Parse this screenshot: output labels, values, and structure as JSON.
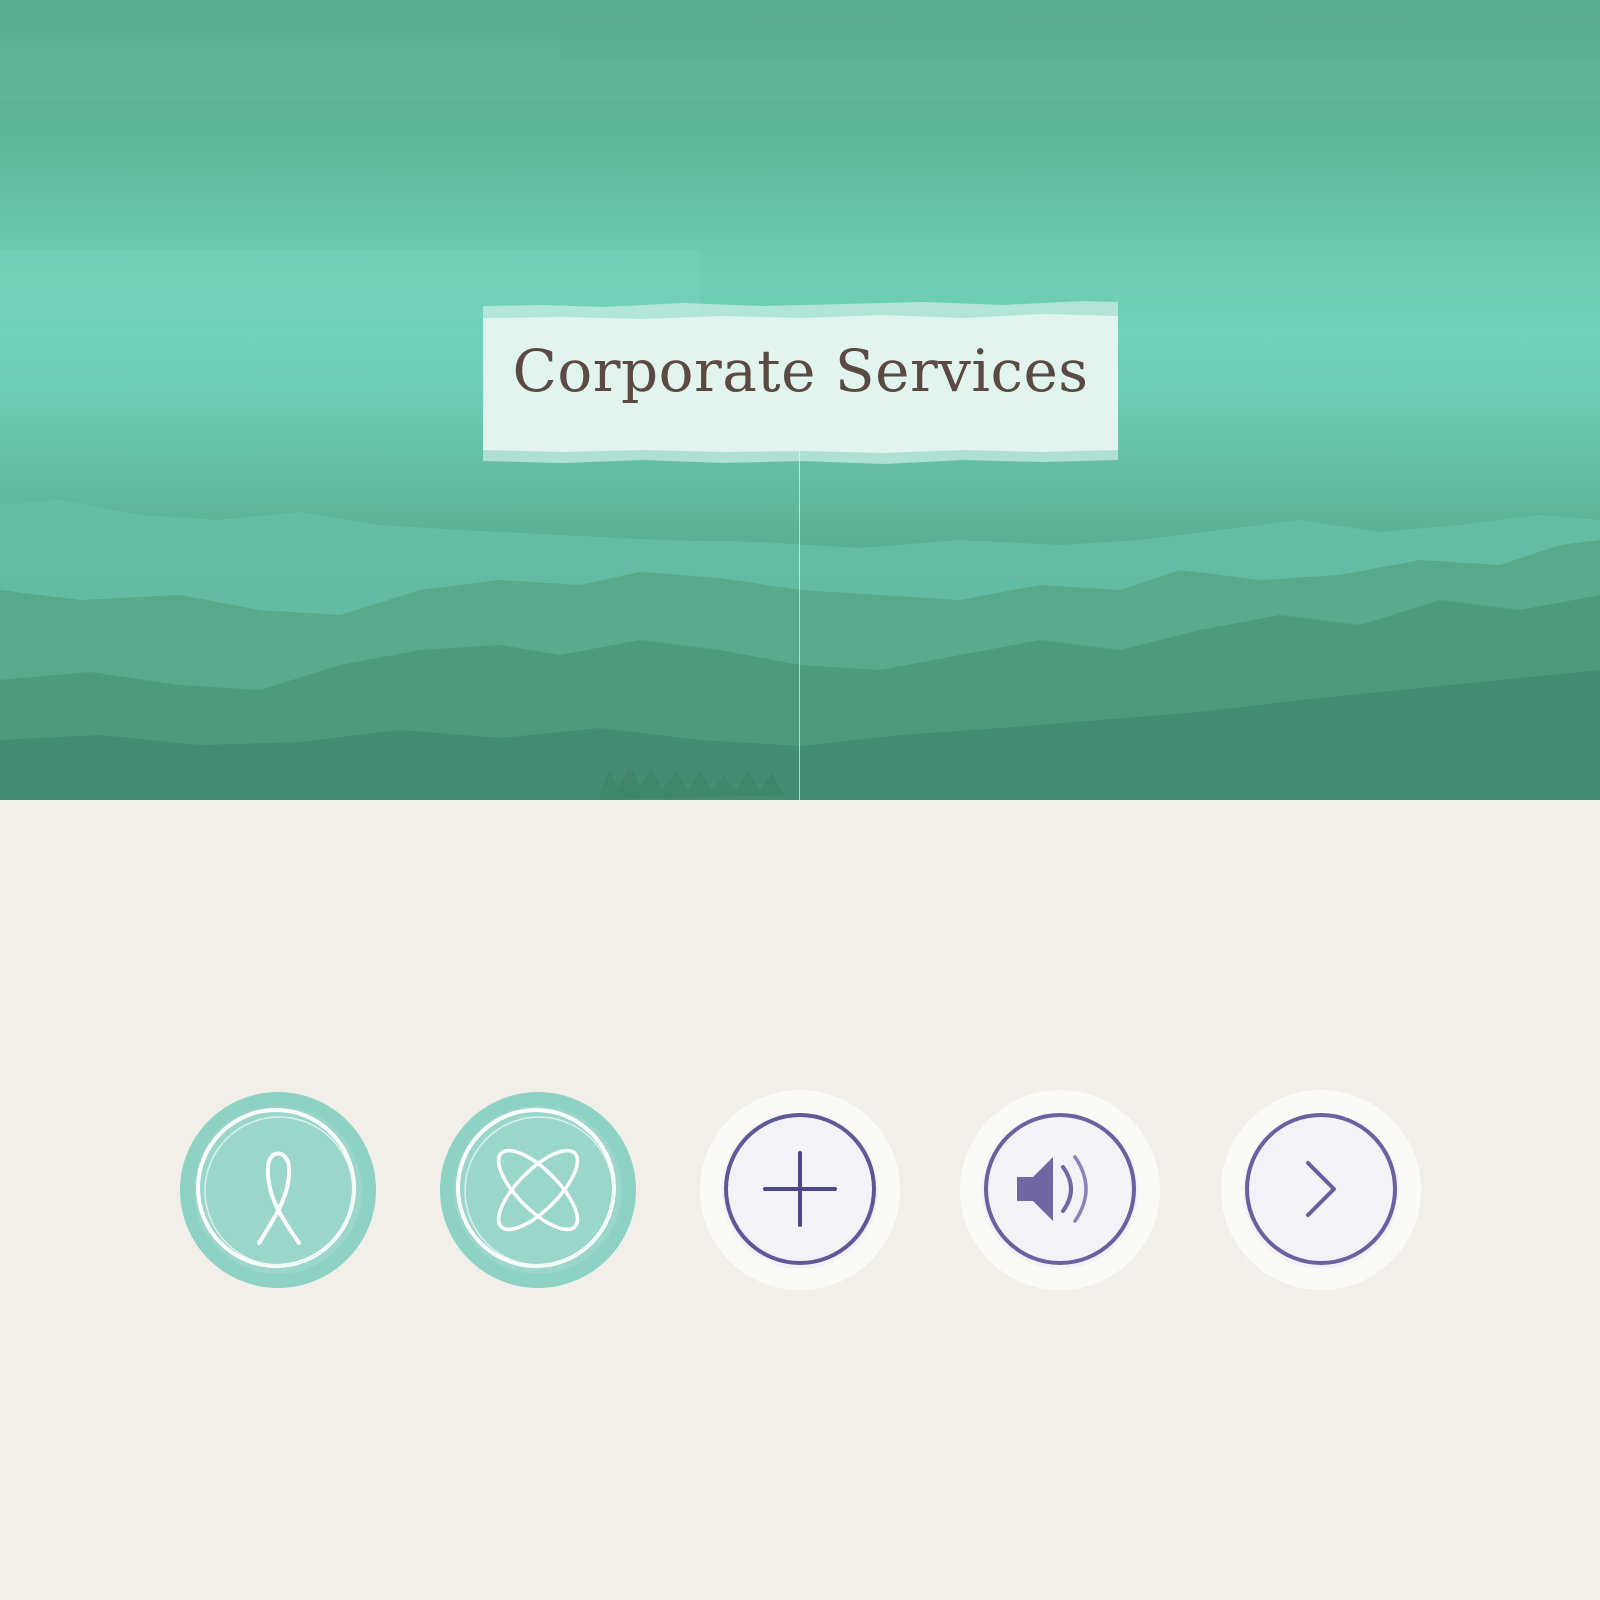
{
  "hero": {
    "title": "Corporate Services"
  },
  "colors": {
    "hero_teal": "#6ccab0",
    "hero_deep": "#468f74",
    "card_fill": "#e1f4ee",
    "title_text": "#5a4a42",
    "page_background": "#f2efe8",
    "teal_button": "#8dd2c4",
    "purple_accent": "#6a62a0",
    "white_button": "#f7f6f9"
  },
  "icon_buttons": [
    {
      "icon": "ribbon-icon",
      "style": "teal"
    },
    {
      "icon": "knot-icon",
      "style": "teal"
    },
    {
      "icon": "plus-icon",
      "style": "white-purple"
    },
    {
      "icon": "speaker-icon",
      "style": "white-purple"
    },
    {
      "icon": "chevron-right-icon",
      "style": "white-purple"
    }
  ]
}
